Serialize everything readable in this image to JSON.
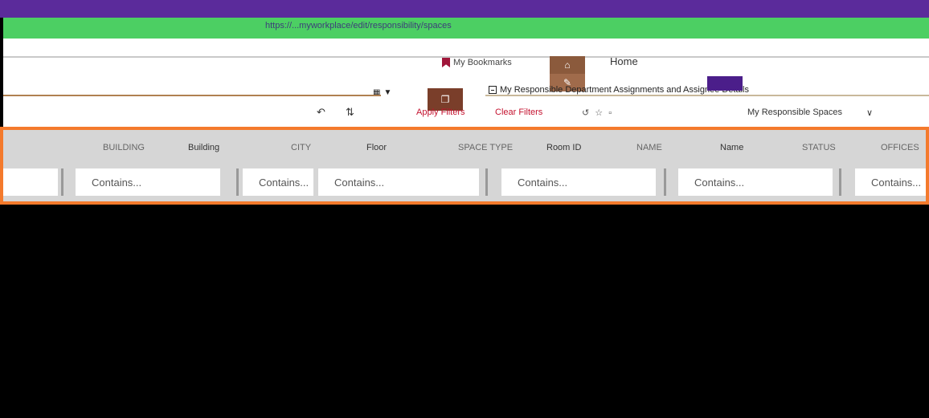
{
  "browser": {
    "url_text": "https://...myworkplace/edit/responsibility/spaces"
  },
  "header": {
    "bookmarks_label": "My Bookmarks",
    "home_label": "Home",
    "assignments_label": "My Responsible Department Assignments and Assignee Details"
  },
  "toolbar": {
    "apply_filters_label": "Apply Filters",
    "clear_filters_label": "Clear Filters",
    "view_label": "My Responsible Spaces",
    "view_caret": "∨"
  },
  "grid": {
    "columns": [
      "BUILDING",
      "Building",
      "CITY",
      "Floor",
      "SPACE TYPE",
      "Room ID",
      "NAME",
      "Name",
      "STATUS",
      "OFFICES"
    ],
    "filter_placeholder": "Contains..."
  },
  "colors": {
    "topbar": "#5b2b9b",
    "url_strip": "#4ccf63",
    "accent": "#f47a2c",
    "link": "#c4122f"
  }
}
